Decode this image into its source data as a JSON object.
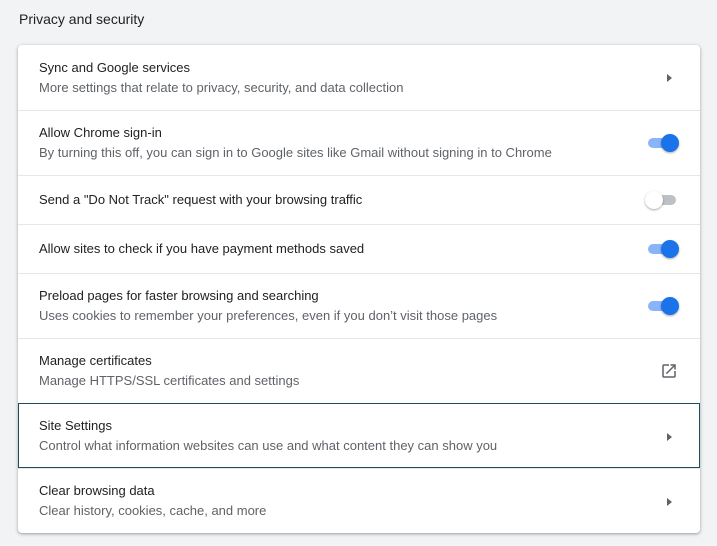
{
  "section": {
    "title": "Privacy and security"
  },
  "rows": [
    {
      "label": "Sync and Google services",
      "sublabel": "More settings that relate to privacy, security, and data collection",
      "control": "arrow"
    },
    {
      "label": "Allow Chrome sign-in",
      "sublabel": "By turning this off, you can sign in to Google sites like Gmail without signing in to Chrome",
      "control": "toggle",
      "enabled": true
    },
    {
      "label": "Send a \"Do Not Track\" request with your browsing traffic",
      "control": "toggle",
      "enabled": false
    },
    {
      "label": "Allow sites to check if you have payment methods saved",
      "control": "toggle",
      "enabled": true
    },
    {
      "label": "Preload pages for faster browsing and searching",
      "sublabel": "Uses cookies to remember your preferences, even if you don’t visit those pages",
      "control": "toggle",
      "enabled": true
    },
    {
      "label": "Manage certificates",
      "sublabel": "Manage HTTPS/SSL certificates and settings",
      "control": "external-link-icon"
    },
    {
      "label": "Site Settings",
      "sublabel": "Control what information websites can use and what content they can show you",
      "control": "arrow",
      "focused": true
    },
    {
      "label": "Clear browsing data",
      "sublabel": "Clear history, cookies, cache, and more",
      "control": "arrow"
    }
  ],
  "colors": {
    "accent": "#1a73e8",
    "accent_track": "#8ab4f8",
    "off_track": "#bdc1c6",
    "focus_outline": "#1f4e5f",
    "secondary_text": "#5f6368"
  }
}
